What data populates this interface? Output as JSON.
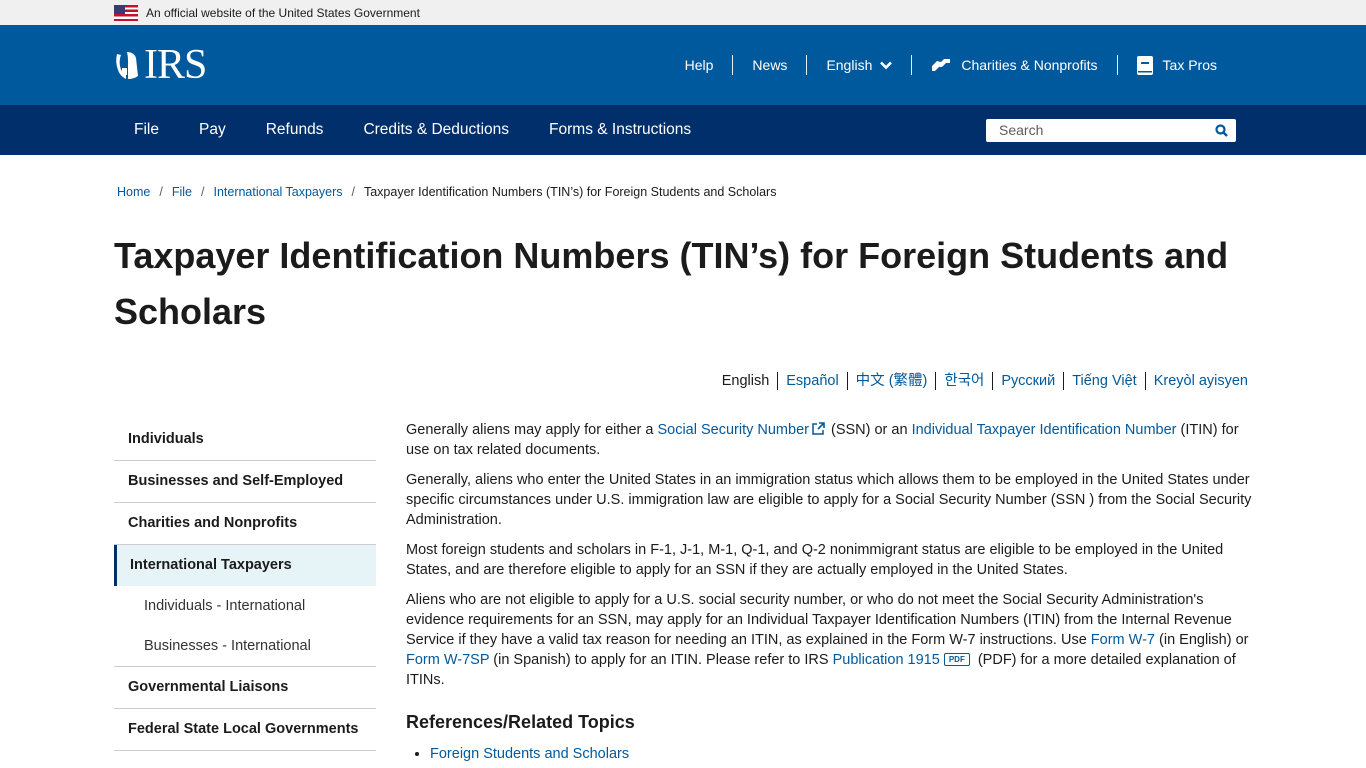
{
  "gov_banner": {
    "text": "An official website of the United States Government"
  },
  "header": {
    "logo_text": "IRS",
    "utility_nav": [
      {
        "label": "Help"
      },
      {
        "label": "News"
      },
      {
        "label": "English",
        "icon": "chevron-down-icon"
      },
      {
        "label": "Charities & Nonprofits",
        "icon": "handshake-icon"
      },
      {
        "label": "Tax Pros",
        "icon": "book-icon"
      }
    ]
  },
  "main_nav": {
    "items": [
      "File",
      "Pay",
      "Refunds",
      "Credits & Deductions",
      "Forms & Instructions"
    ],
    "search_placeholder": "Search"
  },
  "breadcrumb": [
    {
      "label": "Home",
      "link": true
    },
    {
      "label": "File",
      "link": true
    },
    {
      "label": "International Taxpayers",
      "link": true
    },
    {
      "label": "Taxpayer Identification Numbers (TIN’s) for Foreign Students and Scholars",
      "link": false
    }
  ],
  "page_title": "Taxpayer Identification Numbers (TIN’s) for Foreign Students and Scholars",
  "languages": [
    "English",
    "Español",
    "中文 (繁體)",
    "한국어",
    "Русский",
    "Tiếng Việt",
    "Kreyòl ayisyen"
  ],
  "sidebar": {
    "items": [
      {
        "label": "Individuals"
      },
      {
        "label": "Businesses and Self-Employed"
      },
      {
        "label": "Charities and Nonprofits"
      },
      {
        "label": "International Taxpayers",
        "active": true
      },
      {
        "label": "Individuals - International",
        "sub": true
      },
      {
        "label": "Businesses - International",
        "sub": true
      },
      {
        "label": "Governmental Liaisons"
      },
      {
        "label": "Federal State Local Governments"
      }
    ]
  },
  "content": {
    "p1": {
      "a": "Generally aliens may apply for either a ",
      "link1": "Social Security Number",
      "b": " (SSN) or an ",
      "link2": "Individual Taxpayer Identification Number",
      "c": " (ITIN) for use on tax related documents."
    },
    "p2": "Generally, aliens who enter the United States in an immigration status which allows them to be employed in the United States under specific circumstances under U.S. immigration law are eligible to apply for a Social Security Number (SSN ) from the Social Security Administration.",
    "p3": "Most foreign students and scholars in F-1, J-1, M-1, Q-1, and Q-2 nonimmigrant status are eligible to be employed in the United States, and are therefore eligible to apply for an SSN if they are actually employed in the United States.",
    "p4": {
      "a": "Aliens who are not eligible to apply for a U.S. social security number, or who do not meet the Social Security Administration's evidence requirements for an SSN, may apply for an Individual Taxpayer Identification Numbers (ITIN) from the Internal Revenue Service if they have a valid tax reason for needing an ITIN, as explained in the Form W-7 instructions. Use ",
      "link1": "Form W-7",
      "b": " (in English) or ",
      "link2": "Form W-7SP",
      "c": " (in Spanish) to apply for an ITIN.  Please refer to IRS ",
      "link3": "Publication 1915",
      "pdf_badge": "PDF",
      "d": " (PDF) for a more detailed explanation of ITINs."
    },
    "related_heading": "References/Related Topics",
    "related_links": [
      "Foreign Students and Scholars"
    ]
  }
}
